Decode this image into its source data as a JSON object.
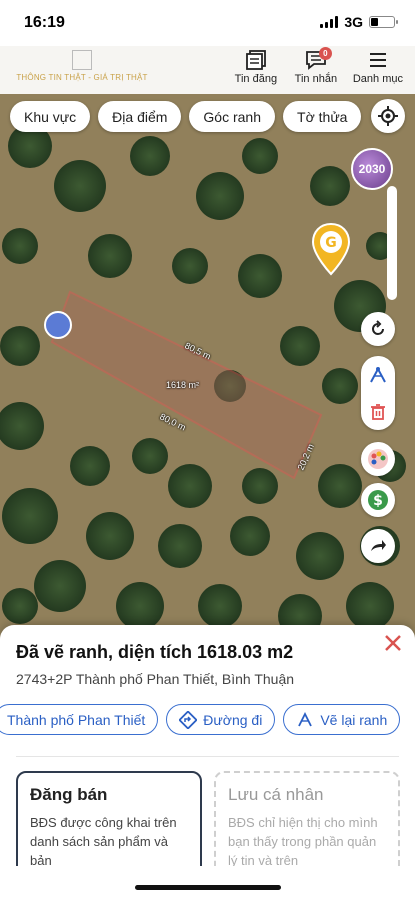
{
  "status_bar": {
    "time": "16:19",
    "network": "3G",
    "battery_level": 0.3
  },
  "header": {
    "logo_text": "THÔNG TIN THẬT - GIÁ TRỊ THẬT",
    "actions": [
      {
        "label": "Tin đăng",
        "icon": "listings-icon"
      },
      {
        "label": "Tin nhắn",
        "icon": "message-icon",
        "badge": "0"
      },
      {
        "label": "Danh mục",
        "icon": "menu-icon"
      }
    ]
  },
  "filters": [
    "Khu vực",
    "Địa điểm",
    "Góc ranh",
    "Tờ thửa"
  ],
  "map": {
    "year": "2030",
    "measurements": {
      "side_top": "80,5 m",
      "side_bottom": "80,0 m",
      "side_right": "20,2 m",
      "area": "1618 m²"
    },
    "accent_color": "#e05454",
    "marker_color": "#f2b623"
  },
  "sheet": {
    "title": "Đã vẽ ranh, diện tích 1618.03 m2",
    "address": "2743+2P Thành phố Phan Thiết, Bình Thuận",
    "actions": [
      "Thành phố Phan Thiết",
      "Đường đi",
      "Vẽ lại ranh"
    ],
    "cards": {
      "sell": {
        "title": "Đăng bán",
        "desc": "BĐS được công khai trên danh sách sản phẩm và bản"
      },
      "save": {
        "title": "Lưu cá nhân",
        "desc": "BĐS chỉ hiện thị cho mình bạn thấy trong phần quản lý tin và trên"
      }
    }
  }
}
